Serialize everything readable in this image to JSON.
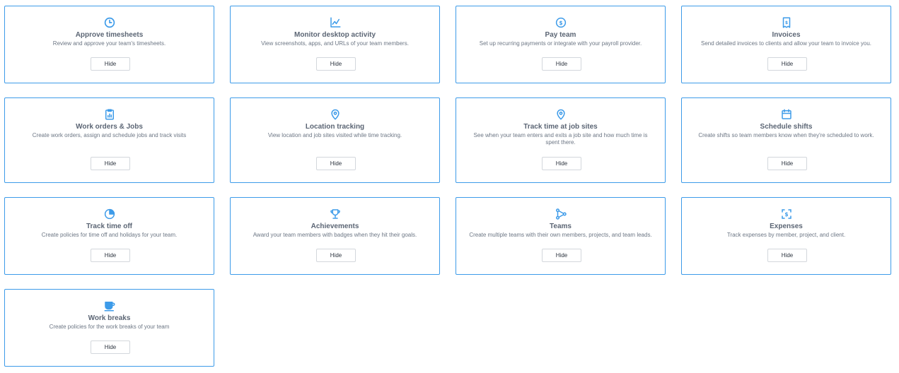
{
  "accent_color": "#3d9be9",
  "cards": [
    {
      "icon": "clock-icon",
      "title": "Approve timesheets",
      "desc": "Review and approve your team's timesheets.",
      "button": "Hide"
    },
    {
      "icon": "chart-activity-icon",
      "title": "Monitor desktop activity",
      "desc": "View screenshots, apps, and URLs of your team members.",
      "button": "Hide"
    },
    {
      "icon": "dollar-circle-icon",
      "title": "Pay team",
      "desc": "Set up recurring payments or integrate with your payroll provider.",
      "button": "Hide"
    },
    {
      "icon": "receipt-icon",
      "title": "Invoices",
      "desc": "Send detailed invoices to clients and allow your team to invoice you.",
      "button": "Hide"
    },
    {
      "icon": "clipboard-icon",
      "title": "Work orders & Jobs",
      "desc": "Create work orders, assign and schedule jobs and track visits",
      "button": "Hide"
    },
    {
      "icon": "location-pin-icon",
      "title": "Location tracking",
      "desc": "View location and job sites visited while time tracking.",
      "button": "Hide"
    },
    {
      "icon": "location-pin-icon",
      "title": "Track time at job sites",
      "desc": "See when your team enters and exits a job site and how much time is spent there.",
      "button": "Hide"
    },
    {
      "icon": "calendar-icon",
      "title": "Schedule shifts",
      "desc": "Create shifts so team members know when they're scheduled to work.",
      "button": "Hide"
    },
    {
      "icon": "pie-chart-icon",
      "title": "Track time off",
      "desc": "Create policies for time off and holidays for your team.",
      "button": "Hide"
    },
    {
      "icon": "trophy-icon",
      "title": "Achievements",
      "desc": "Award your team members with badges when they hit their goals.",
      "button": "Hide"
    },
    {
      "icon": "team-network-icon",
      "title": "Teams",
      "desc": "Create multiple teams with their own members, projects, and team leads.",
      "button": "Hide"
    },
    {
      "icon": "expense-scan-icon",
      "title": "Expenses",
      "desc": "Track expenses by member, project, and client.",
      "button": "Hide"
    },
    {
      "icon": "coffee-cup-icon",
      "title": "Work breaks",
      "desc": "Create policies for the work breaks of your team",
      "button": "Hide"
    }
  ]
}
